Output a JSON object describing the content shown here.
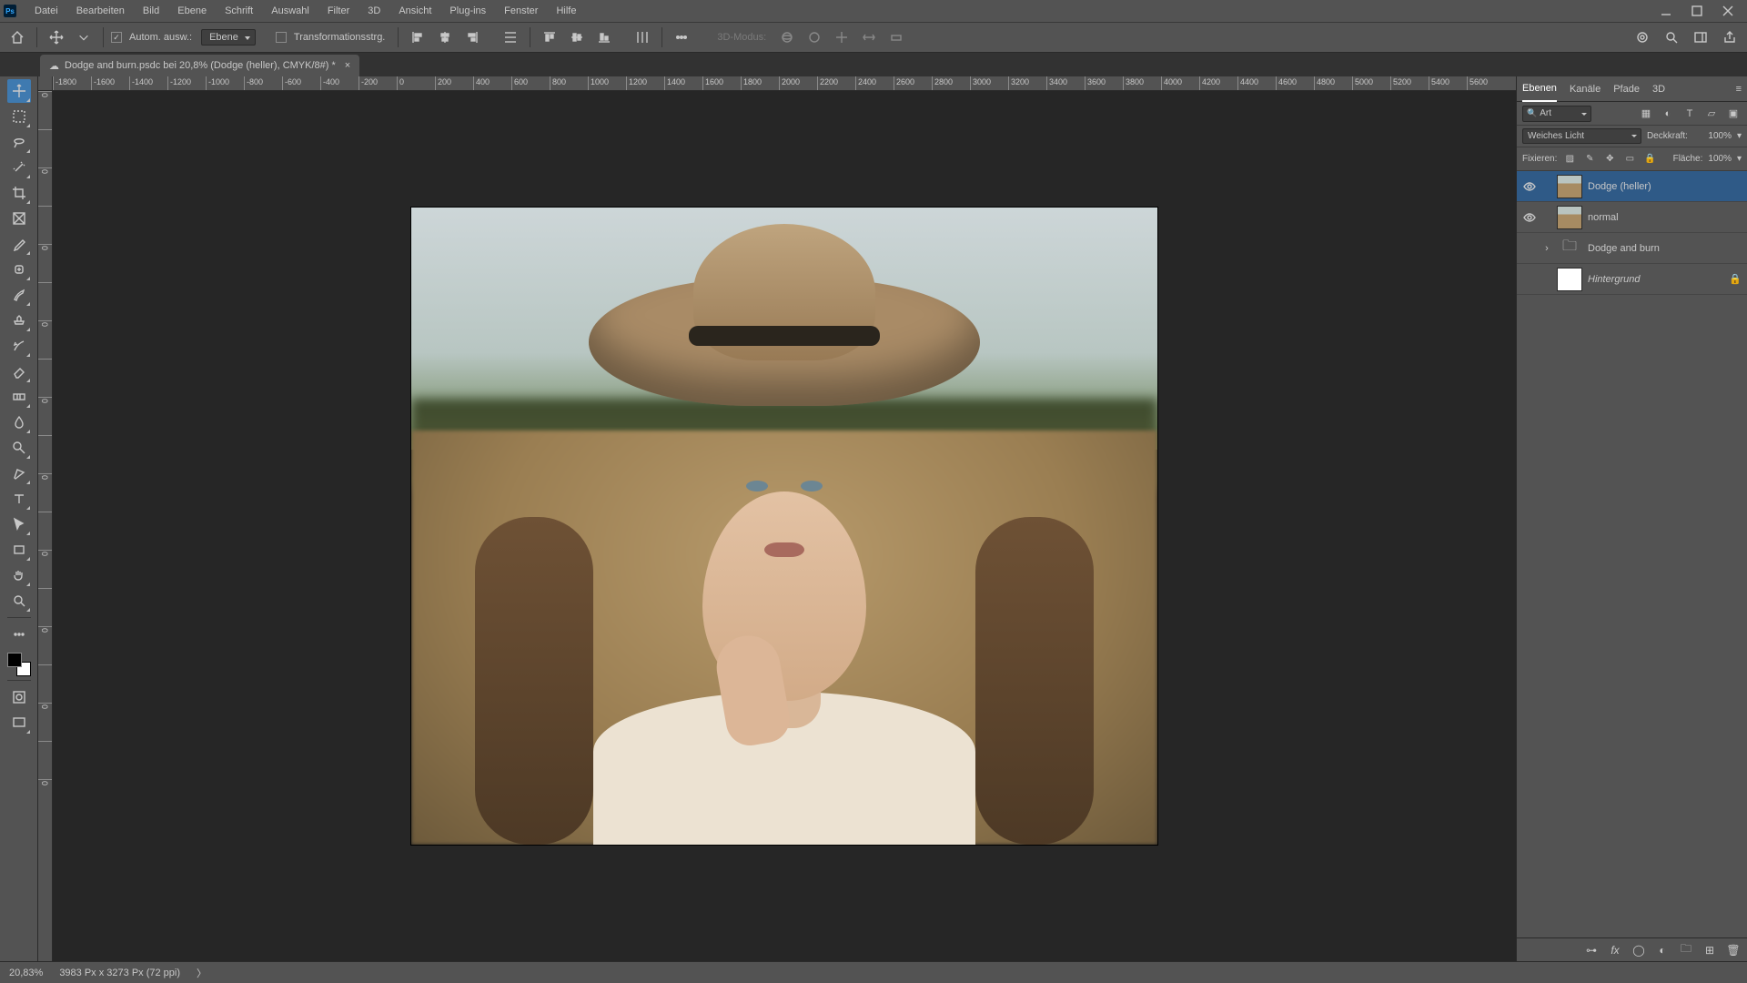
{
  "menubar": [
    "Datei",
    "Bearbeiten",
    "Bild",
    "Ebene",
    "Schrift",
    "Auswahl",
    "Filter",
    "3D",
    "Ansicht",
    "Plug-ins",
    "Fenster",
    "Hilfe"
  ],
  "options": {
    "auto_select_checked": true,
    "auto_select_label": "Autom. ausw.:",
    "auto_select_target": "Ebene",
    "transform_checked": false,
    "transform_label": "Transformationsstrg.",
    "mode3d_disabled": "3D-Modus:"
  },
  "document": {
    "tab_title": "Dodge and burn.psdc bei 20,8% (Dodge (heller), CMYK/8#) *"
  },
  "ruler_h": [
    "-1800",
    "-1600",
    "-1400",
    "-1200",
    "-1000",
    "-800",
    "-600",
    "-400",
    "-200",
    "0",
    "200",
    "400",
    "600",
    "800",
    "1000",
    "1200",
    "1400",
    "1600",
    "1800",
    "2000",
    "2200",
    "2400",
    "2600",
    "2800",
    "3000",
    "3200",
    "3400",
    "3600",
    "3800",
    "4000",
    "4200",
    "4400",
    "4600",
    "4800",
    "5000",
    "5200",
    "5400",
    "5600"
  ],
  "ruler_v": [
    "0",
    "",
    "0",
    "",
    "0",
    "",
    "0",
    "",
    "0",
    "",
    "0",
    "",
    "0",
    "",
    "0",
    "",
    "0",
    "",
    "0"
  ],
  "panels": {
    "tabs": [
      "Ebenen",
      "Kanäle",
      "Pfade",
      "3D"
    ],
    "active_tab": 0,
    "search_kind": "Art",
    "blend_mode": "Weiches Licht",
    "opacity_label": "Deckkraft:",
    "opacity_value": "100%",
    "fill_label": "Fläche:",
    "fill_value": "100%",
    "lock_label": "Fixieren:"
  },
  "layers": [
    {
      "visible": true,
      "thumb": "img",
      "name": "Dodge (heller)",
      "selected": true,
      "italic": false,
      "locked": false,
      "is_group": false
    },
    {
      "visible": true,
      "thumb": "img",
      "name": "normal",
      "selected": false,
      "italic": false,
      "locked": false,
      "is_group": false
    },
    {
      "visible": false,
      "thumb": "folder",
      "name": "Dodge and burn",
      "selected": false,
      "italic": false,
      "locked": false,
      "is_group": true
    },
    {
      "visible": false,
      "thumb": "white",
      "name": "Hintergrund",
      "selected": false,
      "italic": true,
      "locked": true,
      "is_group": false
    }
  ],
  "status": {
    "zoom": "20,83%",
    "doc_info": "3983 Px x 3273 Px (72 ppi)"
  }
}
